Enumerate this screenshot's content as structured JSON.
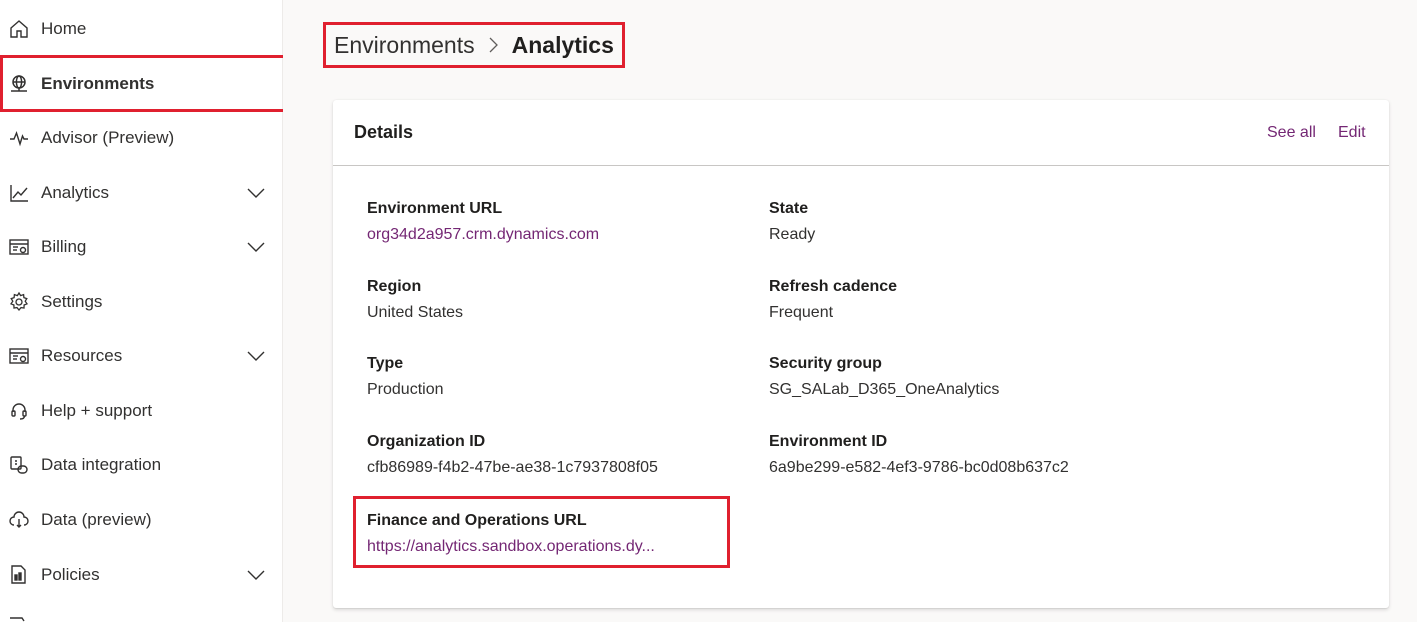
{
  "colors": {
    "accent": "#742774",
    "highlight": "#e0202f",
    "text": "#323130"
  },
  "sidebar": {
    "items": [
      {
        "label": "Home",
        "icon": "home-icon"
      },
      {
        "label": "Environments",
        "icon": "globe-icon",
        "active": true
      },
      {
        "label": "Advisor (Preview)",
        "icon": "pulse-icon"
      },
      {
        "label": "Analytics",
        "icon": "line-chart-icon",
        "expandable": true
      },
      {
        "label": "Billing",
        "icon": "billing-icon",
        "expandable": true
      },
      {
        "label": "Settings",
        "icon": "gear-icon"
      },
      {
        "label": "Resources",
        "icon": "resources-icon",
        "expandable": true
      },
      {
        "label": "Help + support",
        "icon": "headset-icon"
      },
      {
        "label": "Data integration",
        "icon": "data-integration-icon"
      },
      {
        "label": "Data (preview)",
        "icon": "cloud-data-icon"
      },
      {
        "label": "Policies",
        "icon": "policies-icon",
        "expandable": true
      }
    ]
  },
  "breadcrumb": {
    "parent": "Environments",
    "current": "Analytics"
  },
  "details": {
    "title": "Details",
    "see_all": "See all",
    "edit": "Edit",
    "fields": {
      "environment_url": {
        "label": "Environment URL",
        "value": "org34d2a957.crm.dynamics.com"
      },
      "state": {
        "label": "State",
        "value": "Ready"
      },
      "region": {
        "label": "Region",
        "value": "United States"
      },
      "refresh_cadence": {
        "label": "Refresh cadence",
        "value": "Frequent"
      },
      "type": {
        "label": "Type",
        "value": "Production"
      },
      "security_group": {
        "label": "Security group",
        "value": "SG_SALab_D365_OneAnalytics"
      },
      "organization_id": {
        "label": "Organization ID",
        "value": "cfb86989-f4b2-47be-ae38-1c7937808f05"
      },
      "environment_id": {
        "label": "Environment ID",
        "value": "6a9be299-e582-4ef3-9786-bc0d08b637c2"
      },
      "fo_url": {
        "label": "Finance and Operations URL",
        "value": "https://analytics.sandbox.operations.dy..."
      }
    }
  }
}
